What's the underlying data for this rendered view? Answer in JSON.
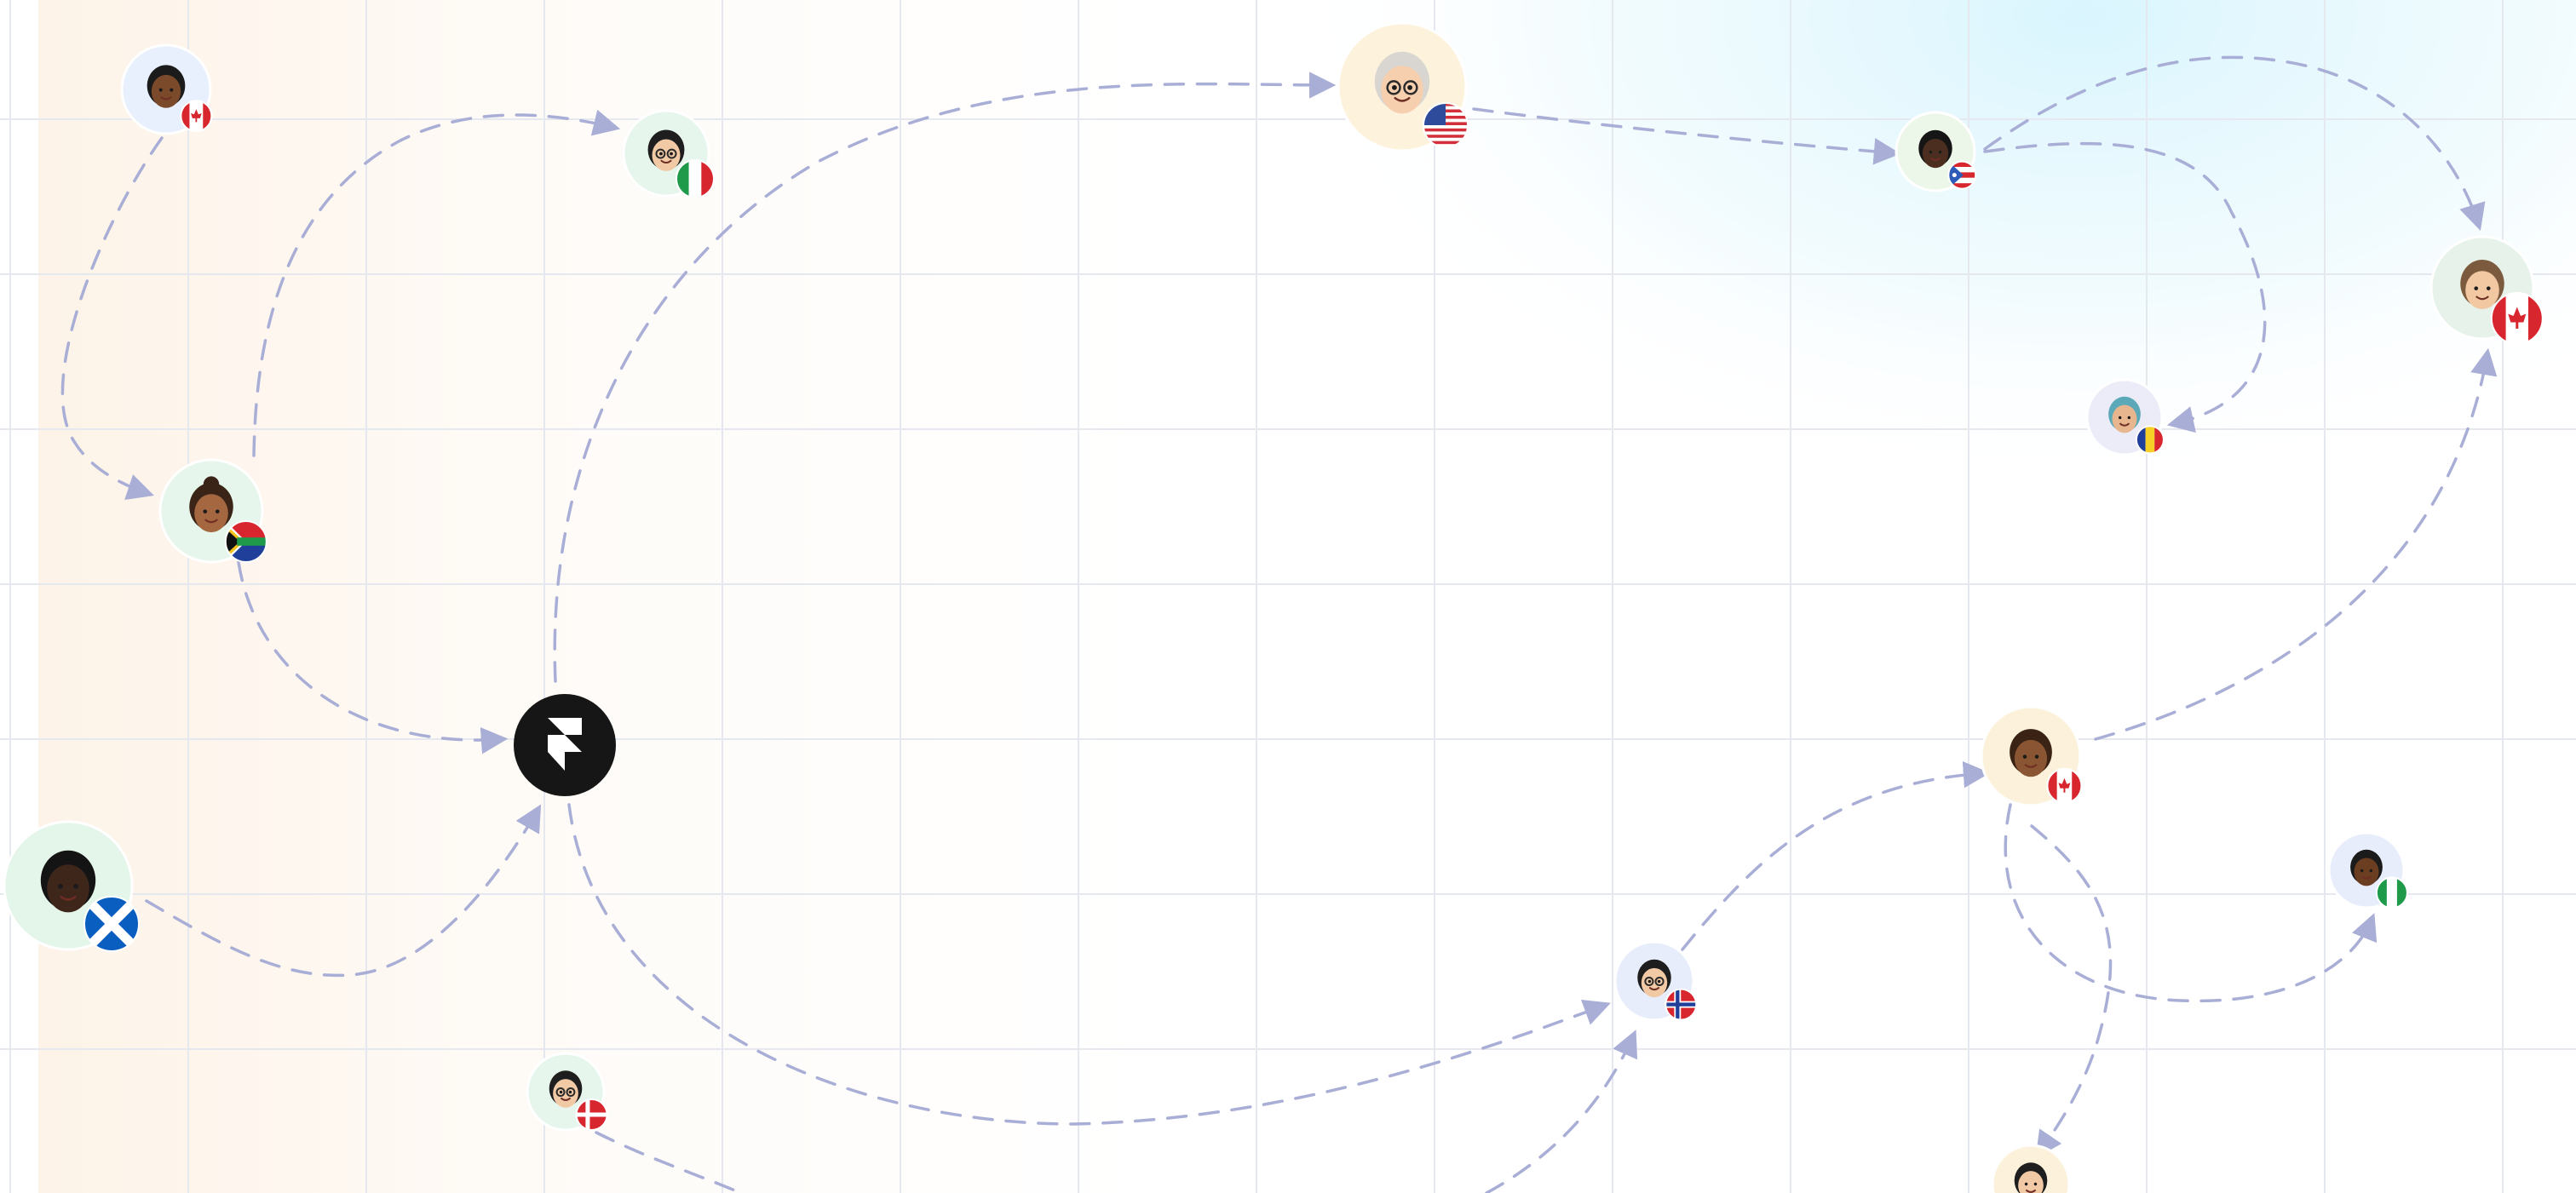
{
  "background": {
    "base": "#ffffff",
    "warm_tint": "#fdf3e8",
    "cool_tint": "#dff6fd",
    "grid_color": "#e6e8ef"
  },
  "edge_color": "#a9aed6",
  "hub": {
    "name": "hub-logo",
    "icon": "framer-logo-icon",
    "fill": "#161616",
    "glyph_color": "#ffffff"
  },
  "users": [
    {
      "id": "user-1",
      "avatar": "memoji-woman-hijab",
      "flag": "canada",
      "halo": "#e9f0fd"
    },
    {
      "id": "user-2",
      "avatar": "memoji-man-glasses",
      "flag": "italy",
      "halo": "#e6f6ec"
    },
    {
      "id": "user-3",
      "avatar": "memoji-grandma-glasses",
      "flag": "united-states",
      "halo": "#fdf3dc"
    },
    {
      "id": "user-4",
      "avatar": "memoji-man-dark",
      "flag": "puerto-rico",
      "halo": "#edf7e9"
    },
    {
      "id": "user-5",
      "avatar": "memoji-man-brown-hair",
      "flag": "canada",
      "halo": "#e7f3ea"
    },
    {
      "id": "user-6",
      "avatar": "memoji-woman-headscarf",
      "flag": "romania",
      "halo": "#ececf8"
    },
    {
      "id": "user-7",
      "avatar": "memoji-woman-bun",
      "flag": "south-africa",
      "halo": "#e6f6ec"
    },
    {
      "id": "user-8",
      "avatar": "memoji-man-smiling",
      "flag": "scotland",
      "halo": "#e4f5e9"
    },
    {
      "id": "user-9",
      "avatar": "memoji-woman-curly",
      "flag": "canada",
      "halo": "#fcf2dc"
    },
    {
      "id": "user-10",
      "avatar": "memoji-woman-hijab-green",
      "flag": "nigeria",
      "halo": "#e7edfb"
    },
    {
      "id": "user-11",
      "avatar": "memoji-man-glasses-wave",
      "flag": "norway",
      "halo": "#e7edfb"
    },
    {
      "id": "user-12",
      "avatar": "memoji-man-glasses-wave",
      "flag": "denmark",
      "halo": "#e6f6ec"
    },
    {
      "id": "user-13",
      "avatar": "memoji-man-partial",
      "flag": "",
      "halo": "#fcf2dc"
    }
  ],
  "connections": [
    {
      "from": "user-1",
      "to": "user-7"
    },
    {
      "from": "user-7",
      "to": "user-2"
    },
    {
      "from": "user-7",
      "to": "hub"
    },
    {
      "from": "hub",
      "to": "user-3"
    },
    {
      "from": "user-3",
      "to": "user-4"
    },
    {
      "from": "user-4",
      "to": "user-5"
    },
    {
      "from": "user-4",
      "to": "user-6"
    },
    {
      "from": "user-9",
      "to": "user-5"
    },
    {
      "from": "user-8",
      "to": "hub"
    },
    {
      "from": "hub",
      "to": "user-11"
    },
    {
      "from": "user-11",
      "to": "user-9"
    },
    {
      "from": "user-9",
      "to": "user-10"
    },
    {
      "from": "user-9",
      "to": "user-13"
    },
    {
      "from": "user-12",
      "to": "offscreen-bottom"
    },
    {
      "from": "offscreen-bottom",
      "to": "user-11"
    }
  ]
}
